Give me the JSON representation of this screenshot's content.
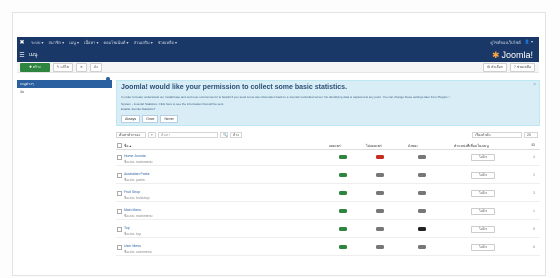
{
  "topbar": {
    "menu": [
      "ระบบ ▾",
      "สมาชิก ▾",
      "เมนู ▾",
      "เนื้อหา ▾",
      "คอมโพเน้นท์ ▾",
      "ส่วนเสริม ▾",
      "ช่วยเหลือ ▾"
    ],
    "right": [
      "ดูไซต์ของเว็บไซต์",
      "👤 ▾"
    ]
  },
  "header": {
    "title": "เมนู",
    "brand": "Joomla!"
  },
  "toolbar": {
    "new": "สร้าง",
    "buttons": [
      "แก้ไข",
      "✕",
      "ถัง"
    ],
    "right": [
      "ตัวเลือก",
      "ช่วยเหลือ"
    ]
  },
  "sidebar": {
    "items": [
      "เมนูต่างๆ",
      "จัด"
    ]
  },
  "notice": {
    "heading": "Joomla! would like your permission to collect some basic statistics.",
    "line1": "In order to better understand our install base and end user environment it is helpful if you send some site information back to a Joomla! controlled server. No identifying data is captured at any point. You can change these settings later from Plugins >",
    "line2": "System - Joomla! Statistics. Click here to see the information that will be sent.",
    "line3": "Enable Joomla Statistics?",
    "buttons": [
      "Always",
      "Once",
      "Never"
    ]
  },
  "filters": {
    "search_label": "ค้นหาตัวกรอง",
    "search_placeholder": "ค้นหา",
    "clear": "ล้าง",
    "sort": "เรียงลำดับ",
    "limit": "20"
  },
  "table": {
    "headers": [
      "ชื่อ ▴",
      "เผยแพร่",
      "ไม่เผยแพร่",
      "ถังขยะ",
      "ตำแหน่งที่เชื่อมโยงเมนู",
      "ID"
    ],
    "rows": [
      {
        "name": "Home Joomla",
        "alias": "ชื่อเล่น: mainmenu",
        "pub": "#2e8540",
        "unpub": "#c62d1f",
        "trash": "#777777",
        "id": "4"
      },
      {
        "name": "Australian Parks",
        "alias": "ชื่อเล่น: parks",
        "pub": "#2e8540",
        "unpub": "#777777",
        "trash": "#777777",
        "id": "2"
      },
      {
        "name": "Fruit Shop",
        "alias": "ชื่อเล่น: fruitshop",
        "pub": "#2e8540",
        "unpub": "#777777",
        "trash": "#777777",
        "id": "3"
      },
      {
        "name": "Main Menu",
        "alias": "ชื่อเล่น: mainmenu",
        "pub": "#2e8540",
        "unpub": "#777777",
        "trash": "#777777",
        "id": "1"
      },
      {
        "name": "Top",
        "alias": "ชื่อเล่น: top",
        "pub": "#2e8540",
        "unpub": "#777777",
        "trash": "#222222",
        "id": "5"
      },
      {
        "name": "User Menu",
        "alias": "ชื่อเล่น: usermenu",
        "pub": "#2e8540",
        "unpub": "#777777",
        "trash": "#777777",
        "id": "6"
      }
    ],
    "select_label": "ไม่มี ▾"
  }
}
